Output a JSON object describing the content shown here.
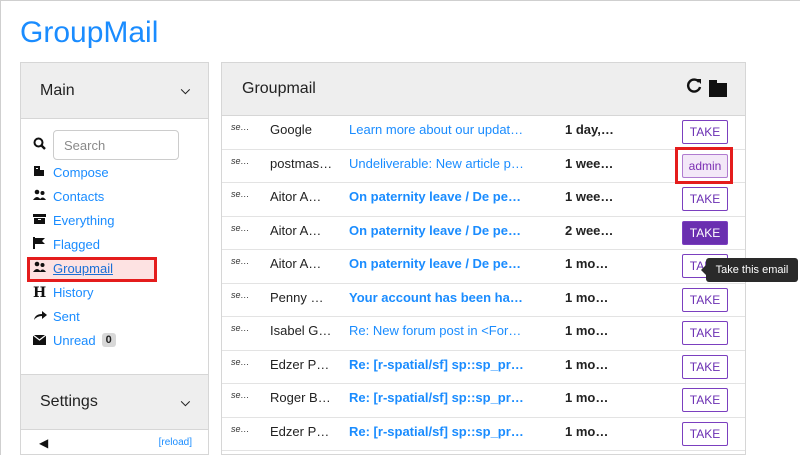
{
  "app": {
    "title": "GroupMail"
  },
  "sidebar": {
    "main_header": "Main",
    "search": {
      "placeholder": "Search",
      "value": ""
    },
    "items": [
      {
        "label": "Compose",
        "icon": "compose-icon"
      },
      {
        "label": "Contacts",
        "icon": "contacts-icon"
      },
      {
        "label": "Everything",
        "icon": "everything-icon"
      },
      {
        "label": "Flagged",
        "icon": "flag-icon"
      },
      {
        "label": "Groupmail",
        "icon": "group-icon",
        "active": true
      },
      {
        "label": "History",
        "icon": "history-icon"
      },
      {
        "label": "Sent",
        "icon": "sent-icon"
      },
      {
        "label": "Unread",
        "icon": "unread-icon",
        "count": "0"
      }
    ],
    "settings_header": "Settings",
    "reload_label": "[reload]"
  },
  "panel": {
    "title": "Groupmail",
    "rows": [
      {
        "sel": "se…",
        "from": "Google",
        "subject": "Learn more about our updat…",
        "bold": false,
        "date": "1 day,…",
        "action": "TAKE",
        "style": "outline"
      },
      {
        "sel": "se…",
        "from": "postmas…",
        "subject": "Undeliverable: New article p…",
        "bold": false,
        "date": "1 wee…",
        "action": "admin",
        "style": "admin"
      },
      {
        "sel": "se…",
        "from": "Aitor A…",
        "subject": "On paternity leave / De pe…",
        "bold": true,
        "date": "1 wee…",
        "action": "TAKE",
        "style": "outline"
      },
      {
        "sel": "se…",
        "from": "Aitor A…",
        "subject": "On paternity leave / De pe…",
        "bold": true,
        "date": "2 wee…",
        "action": "TAKE",
        "style": "filled"
      },
      {
        "sel": "se…",
        "from": "Aitor A…",
        "subject": "On paternity leave / De pe…",
        "bold": true,
        "date": "1 mo…",
        "action": "TAKE",
        "style": "outline"
      },
      {
        "sel": "se…",
        "from": "Penny …",
        "subject": "Your account has been ha…",
        "bold": true,
        "date": "1 mo…",
        "action": "TAKE",
        "style": "outline"
      },
      {
        "sel": "se…",
        "from": "Isabel G…",
        "subject": "Re: New forum post in <For…",
        "bold": false,
        "date": "1 mo…",
        "action": "TAKE",
        "style": "outline"
      },
      {
        "sel": "se…",
        "from": "Edzer P…",
        "subject": "Re: [r-spatial/sf] sp::sp_pr…",
        "bold": true,
        "date": "1 mo…",
        "action": "TAKE",
        "style": "outline"
      },
      {
        "sel": "se…",
        "from": "Roger B…",
        "subject": "Re: [r-spatial/sf] sp::sp_pr…",
        "bold": true,
        "date": "1 mo…",
        "action": "TAKE",
        "style": "outline"
      },
      {
        "sel": "se…",
        "from": "Edzer P…",
        "subject": "Re: [r-spatial/sf] sp::sp_pr…",
        "bold": true,
        "date": "1 mo…",
        "action": "TAKE",
        "style": "outline"
      }
    ],
    "tooltip": "Take this email"
  },
  "colors": {
    "accent": "#1a8cff",
    "take": "#6a2fb0",
    "highlight": "#e41c1c"
  }
}
